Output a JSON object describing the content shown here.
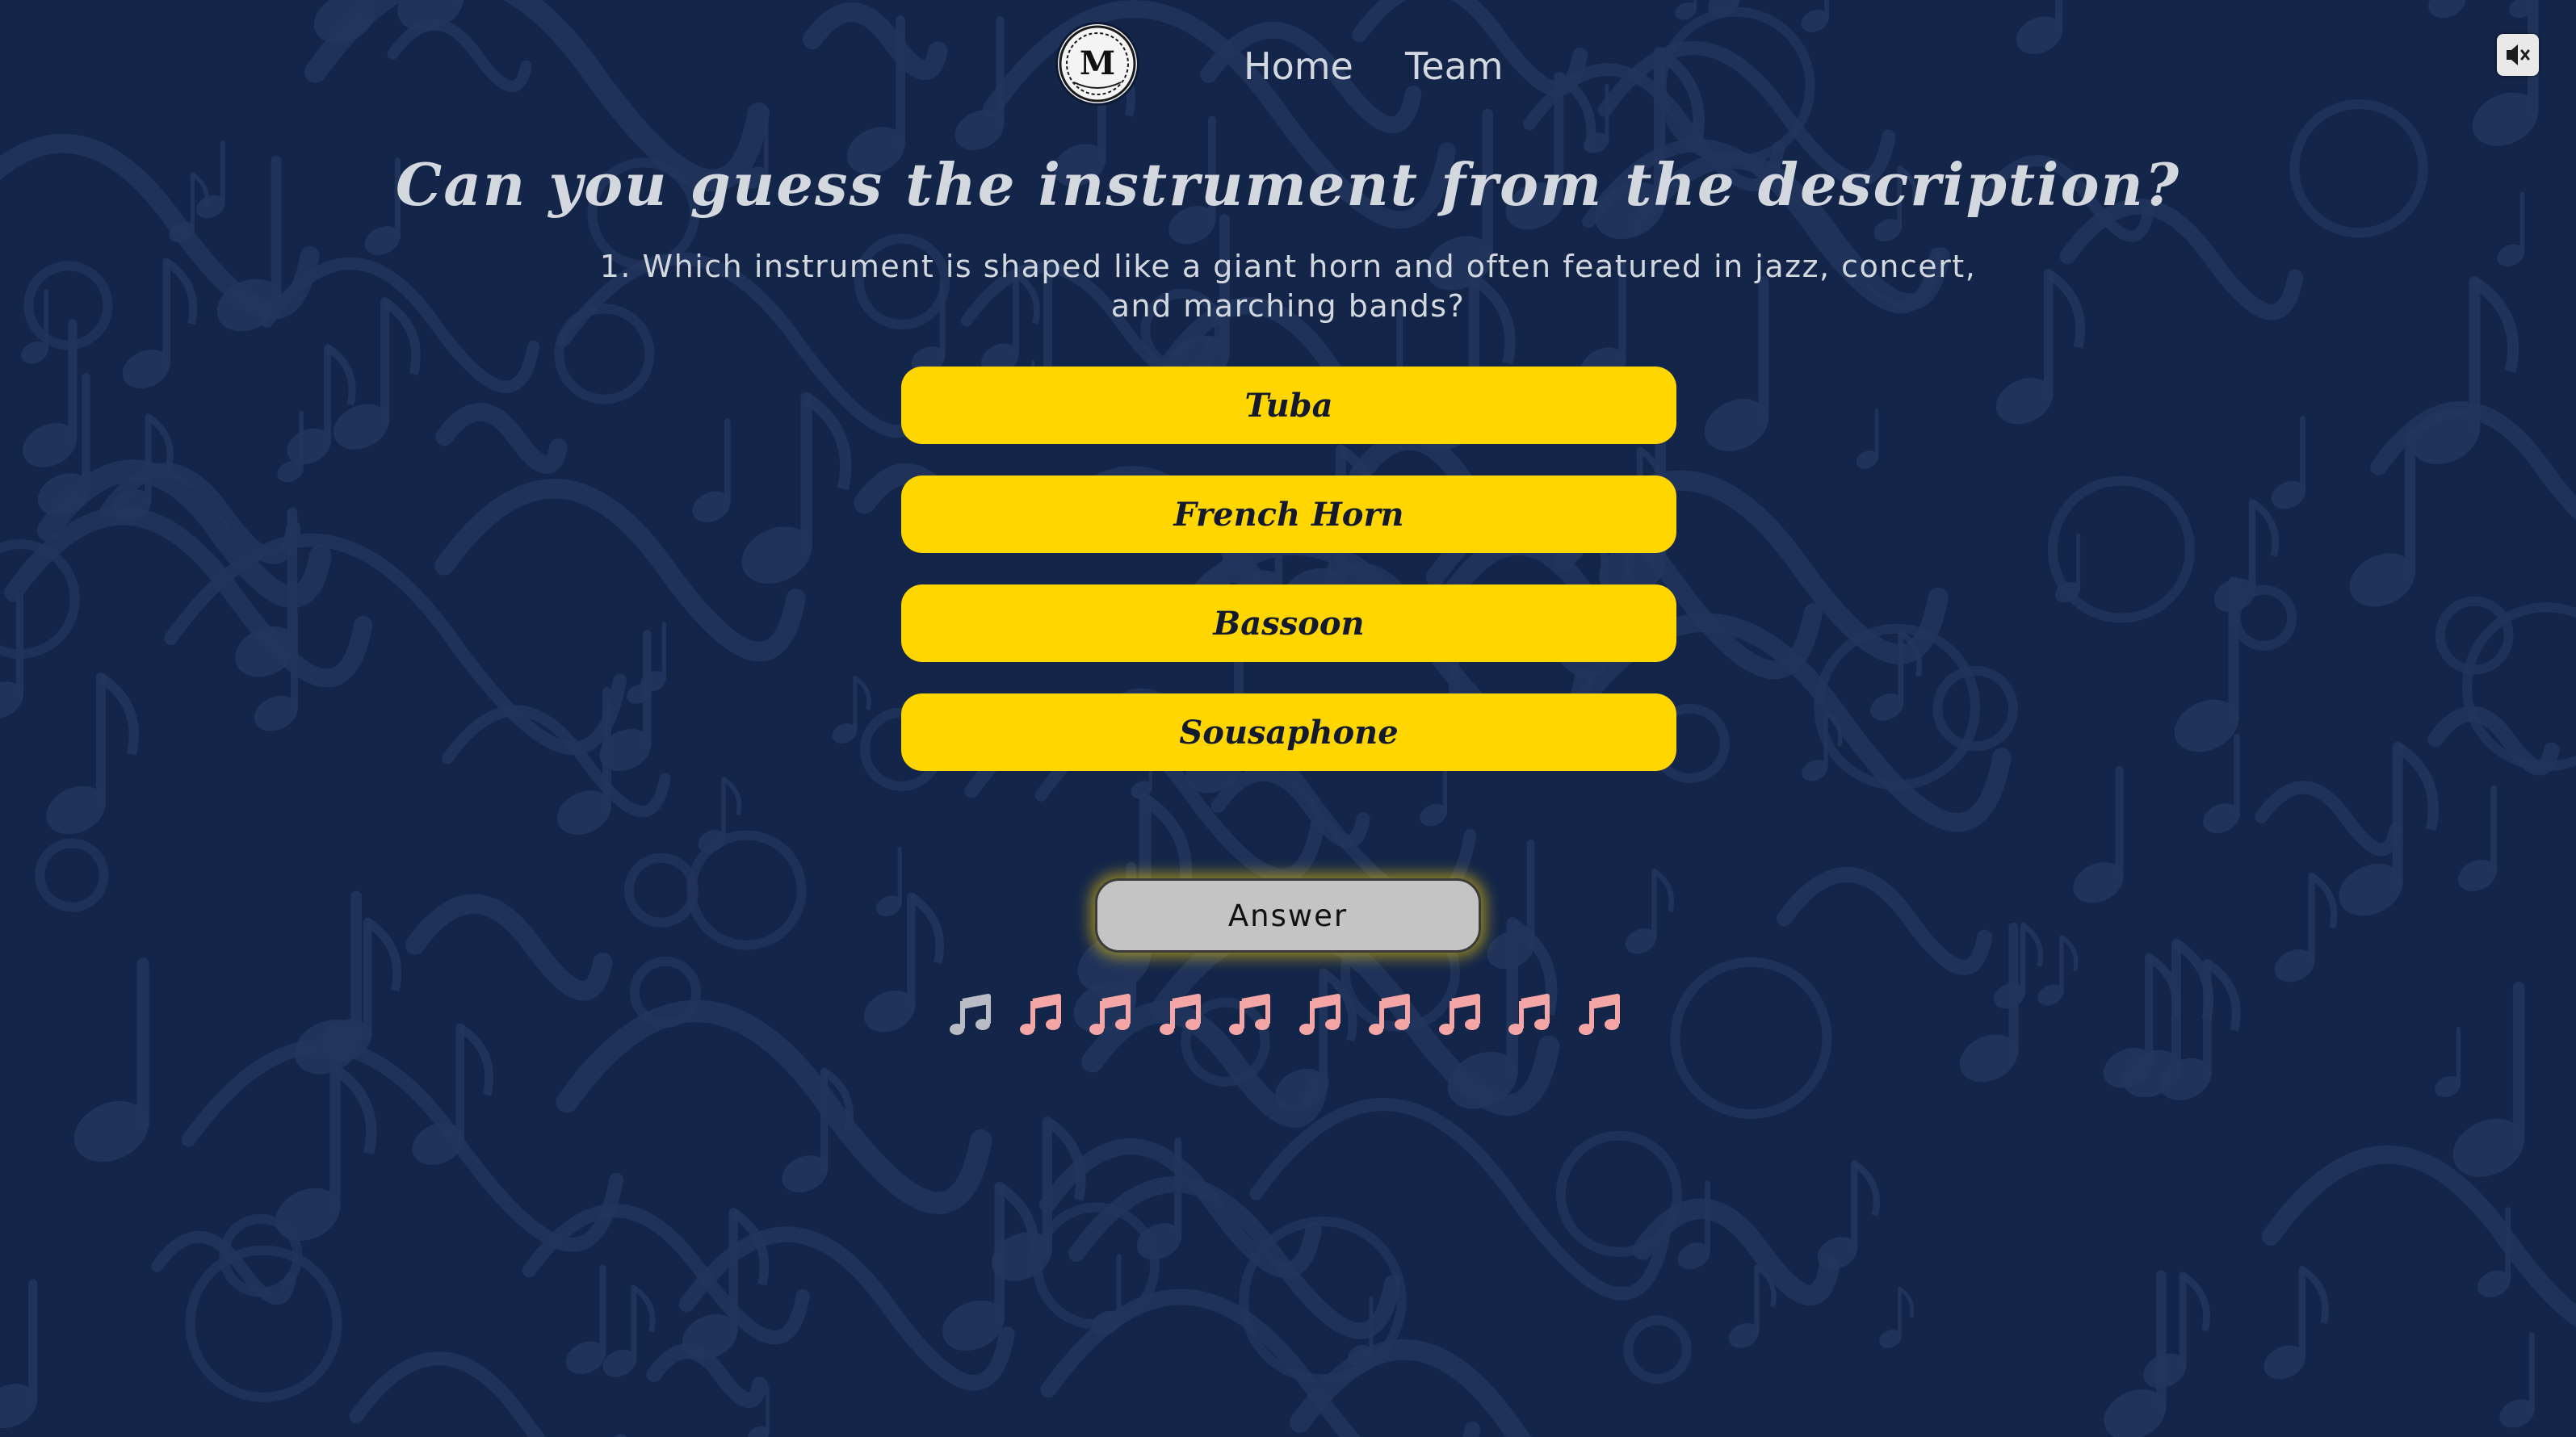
{
  "header": {
    "logo_letter": "M",
    "nav": [
      {
        "label": "Home"
      },
      {
        "label": "Team"
      }
    ],
    "mute_icon": "speaker-muted-icon"
  },
  "quiz": {
    "title": "Can you guess the instrument from the description?",
    "question": "1. Which instrument is shaped like a giant horn and often featured in jazz, concert, and marching bands?",
    "options": [
      {
        "label": "Tuba"
      },
      {
        "label": "French Horn"
      },
      {
        "label": "Bassoon"
      },
      {
        "label": "Sousaphone"
      }
    ],
    "answer_label": "Answer",
    "progress": {
      "total": 10,
      "current": 1,
      "icon": "music-note-icon",
      "current_color": "#b9bcc4",
      "remaining_color": "#f4a6a6"
    }
  },
  "colors": {
    "background": "#132549",
    "option": "#ffd600",
    "answer_button": "#c4c4c4",
    "answer_glow": "#ffd600"
  }
}
